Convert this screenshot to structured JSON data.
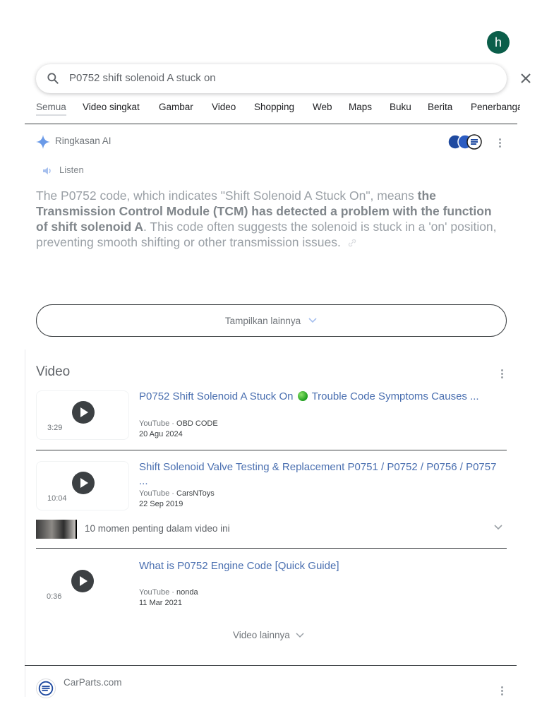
{
  "account": {
    "initial": "h",
    "color": "#0b5e4a"
  },
  "search": {
    "query": "P0752 shift solenoid A stuck on"
  },
  "tabs": [
    "Semua",
    "Video singkat",
    "Gambar",
    "Video",
    "Shopping",
    "Web",
    "Maps",
    "Buku",
    "Berita",
    "Penerbangan"
  ],
  "active_tab": "Semua",
  "ai_overview": {
    "label": "Ringkasan AI",
    "listen": "Listen",
    "text_pre": "The P0752 code, which indicates \"Shift Solenoid A Stuck On\", means ",
    "text_bold": "the Transmission Control Module (TCM) has detected a problem with the function of shift solenoid A",
    "text_post": ". This code often suggests the solenoid is stuck in a 'on' position, preventing smooth shifting or other transmission issues.",
    "show_more": "Tampilkan lainnya"
  },
  "videos": {
    "heading": "Video",
    "items": [
      {
        "title_pre": "P0752 Shift Solenoid A Stuck On",
        "title_post": "Trouble Code Symptoms Causes ...",
        "duration": "3:29",
        "source": "YouTube",
        "channel": "OBD CODE",
        "date": "20 Agu 2024"
      },
      {
        "title": "Shift Solenoid Valve Testing & Replacement P0751 / P0752 / P0756 / P0757 ...",
        "duration": "10:04",
        "source": "YouTube",
        "channel": "CarsNToys",
        "date": "22 Sep 2019"
      },
      {
        "title": "What is P0752 Engine Code [Quick Guide]",
        "duration": "0:36",
        "source": "YouTube",
        "channel": "nonda",
        "date": "11 Mar 2021"
      }
    ],
    "key_moments": "10 momen penting dalam video ini",
    "more": "Video lainnya"
  },
  "next_result": {
    "site": "CarParts.com"
  }
}
